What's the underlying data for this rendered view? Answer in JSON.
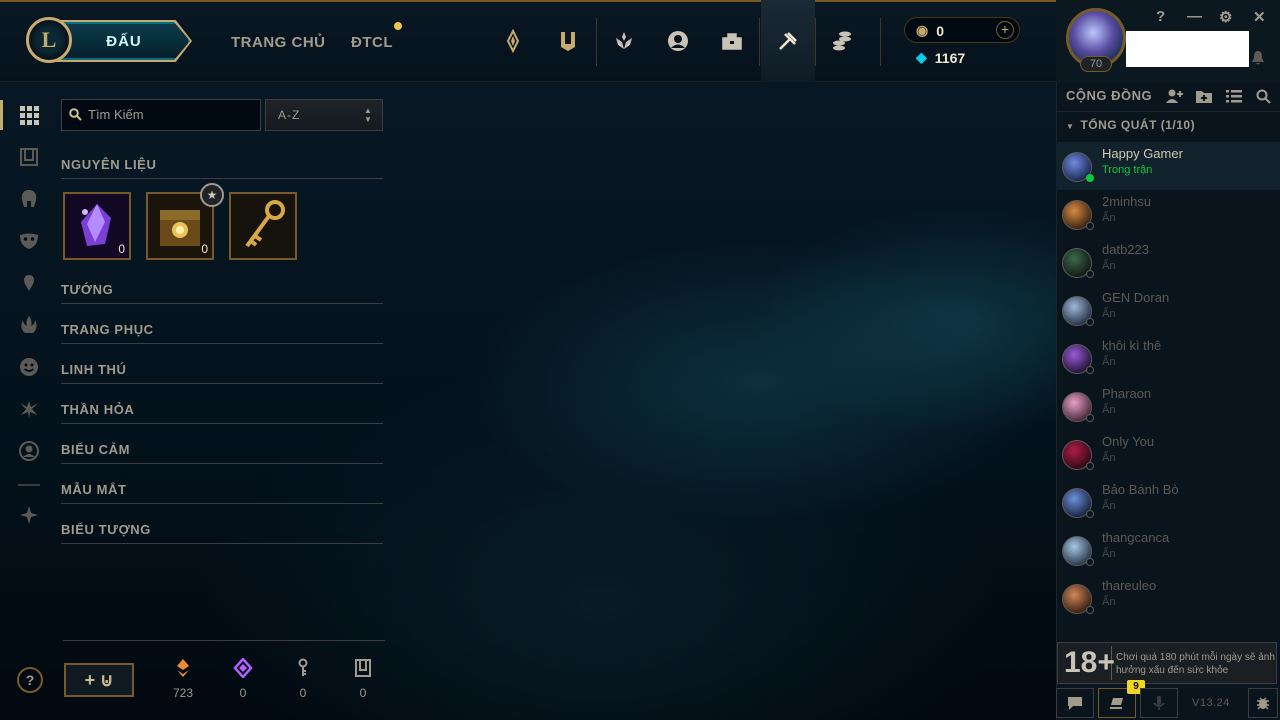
{
  "header": {
    "logo_letter": "L",
    "play_label": "ĐẤU",
    "nav": {
      "home": "TRANG CHỦ",
      "tft": "ĐTCL"
    },
    "riot_points": "0",
    "blue_essence": "1167",
    "level": "70",
    "window": {
      "help": "?",
      "minimize": "—",
      "settings": "⚙",
      "close": "✕"
    }
  },
  "loot": {
    "search_placeholder": "Tìm Kiếm",
    "sort_value": "A-Z",
    "sections": {
      "materials": "NGUYÊN LIỆU",
      "champions": "TƯỚNG",
      "skins": "TRANG PHỤC",
      "companions": "LINH THÚ",
      "ward_skins": "THẦN HỎA",
      "emotes": "BIỂU CẢM",
      "chromas": "MẪU MẮT",
      "icons": "BIỂU TƯỢNG"
    },
    "items": [
      {
        "name": "Mảnh tinh hoa",
        "count": "0"
      },
      {
        "name": "Rương",
        "count": "0"
      },
      {
        "name": "Chìa khóa",
        "count": ""
      }
    ],
    "footer": {
      "help": "?",
      "craft_label": "+",
      "orange_essence": "723",
      "mythic_essence": "0",
      "key_fragments": "0",
      "chests": "0"
    }
  },
  "social": {
    "title": "CỘNG ĐỒNG",
    "group": "TỔNG QUÁT (1/10)",
    "friends": [
      {
        "name": "Happy Gamer",
        "status": "Trong trận"
      },
      {
        "name": "2minhsu",
        "status": "Ẩn"
      },
      {
        "name": "datb223",
        "status": "Ẩn"
      },
      {
        "name": "GEN Doran",
        "status": "Ẩn"
      },
      {
        "name": "khôi kì thê",
        "status": "Ẩn"
      },
      {
        "name": "Pharaon",
        "status": "Ẩn"
      },
      {
        "name": "Only You",
        "status": "Ẩn"
      },
      {
        "name": "Bảo Bánh Bò",
        "status": "Ẩn"
      },
      {
        "name": "thangcanca",
        "status": "Ẩn"
      },
      {
        "name": "thareuleo",
        "status": "Ẩn"
      }
    ],
    "age_rating": "18+",
    "age_warning": "Chơi quá 180 phút mỗi ngày sẽ ảnh hưởng xấu đến sức khỏe",
    "notification_count": "9",
    "version": "V13.24"
  },
  "colors": {
    "gold": "#c8aa6e",
    "online": "#0acb3c",
    "accent": "#0acbe6"
  }
}
